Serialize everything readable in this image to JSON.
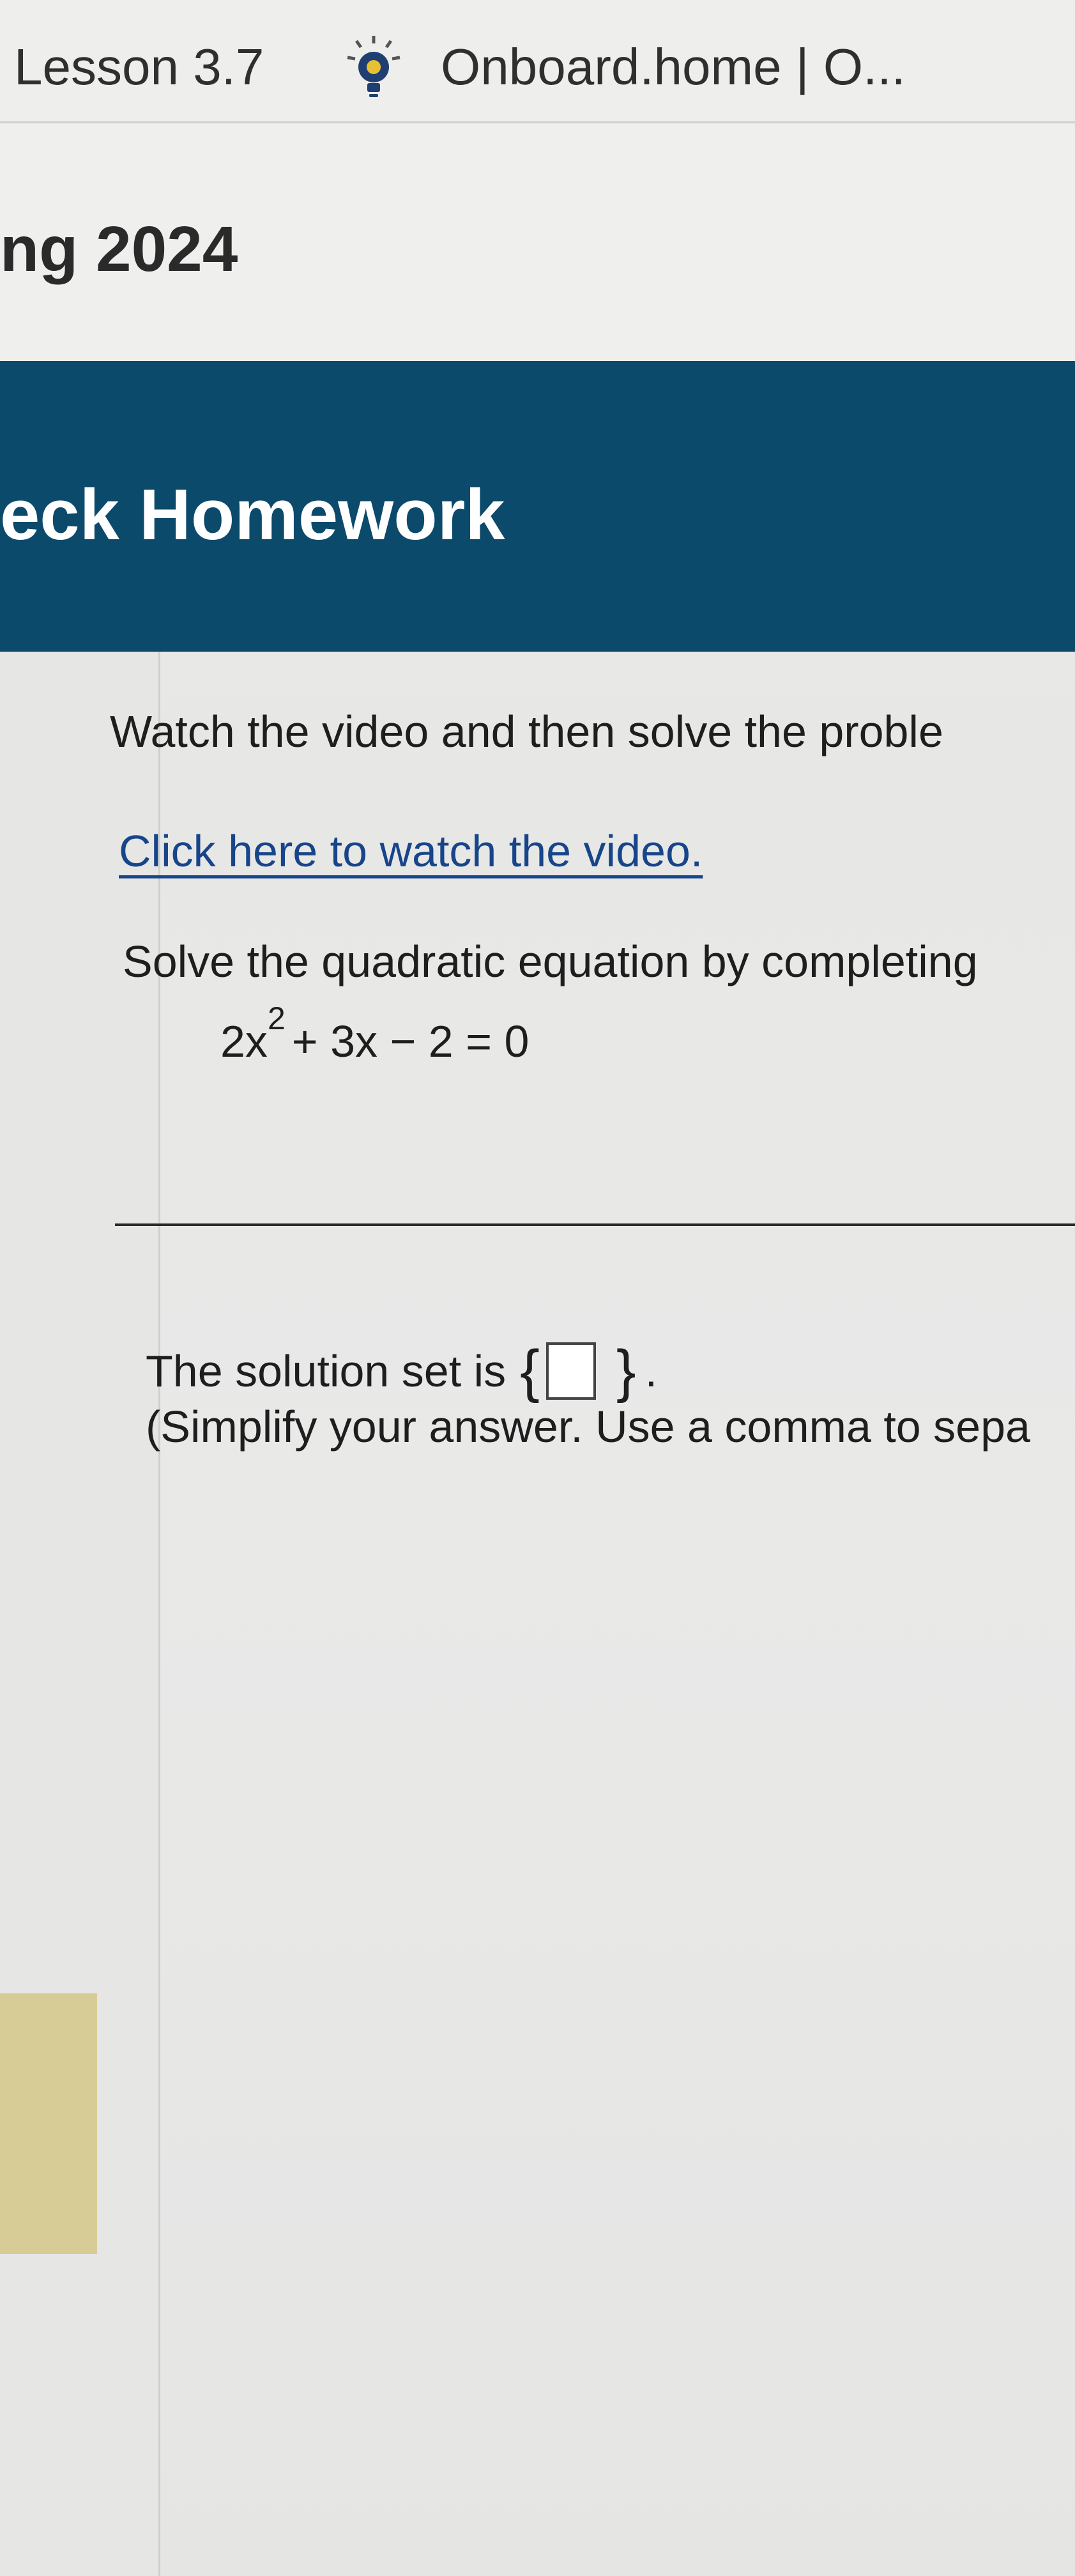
{
  "bookmarks_bar": {
    "items": [
      {
        "label": "Lesson 3.7"
      },
      {
        "label": "Onboard.home | O...",
        "icon": "lightbulb-icon"
      }
    ]
  },
  "course": {
    "title": "ng 2024"
  },
  "banner": {
    "title": "eck Homework",
    "background_color": "#0c4a6b"
  },
  "question": {
    "instructions": "Watch the video and then solve the proble",
    "video_link_text": "Click here to watch the video.",
    "problem_text": "Solve the quadratic equation by completing",
    "equation": {
      "coefficient": "2x",
      "exponent": "2",
      "rest": "+ 3x − 2 = 0"
    },
    "answer_prefix": "The solution set is",
    "open_brace": "{",
    "close_brace": "}",
    "answer_suffix": ".",
    "answer_value": "",
    "hint": "(Simplify your answer. Use a comma to sepa"
  },
  "colors": {
    "link": "#17458a",
    "sidebar_highlight": "#d8cc96"
  }
}
